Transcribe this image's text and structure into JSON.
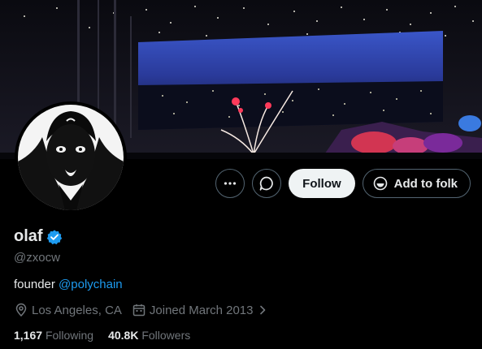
{
  "banner": {
    "icon": "night-city-window-image"
  },
  "avatar": {
    "icon": "portrait-avatar"
  },
  "actions": {
    "more_icon": "more-dots-icon",
    "message_icon": "message-bubble-icon",
    "follow_label": "Follow",
    "folk_label": "Add to folk",
    "folk_icon": "folk-logo-icon"
  },
  "profile": {
    "name": "olaf",
    "verified_icon": "verified-badge-icon",
    "handle": "@zxocw",
    "bio_text": "founder ",
    "bio_mention": "@polychain",
    "location": "Los Angeles, CA",
    "joined": "Joined March 2013",
    "following_count": "1,167",
    "following_label": "Following",
    "followers_count": "40.8K",
    "followers_label": "Followers"
  },
  "colors": {
    "accent": "#1d9bf0",
    "secondary_text": "#71767b",
    "follow_bg": "#eff3f4"
  }
}
